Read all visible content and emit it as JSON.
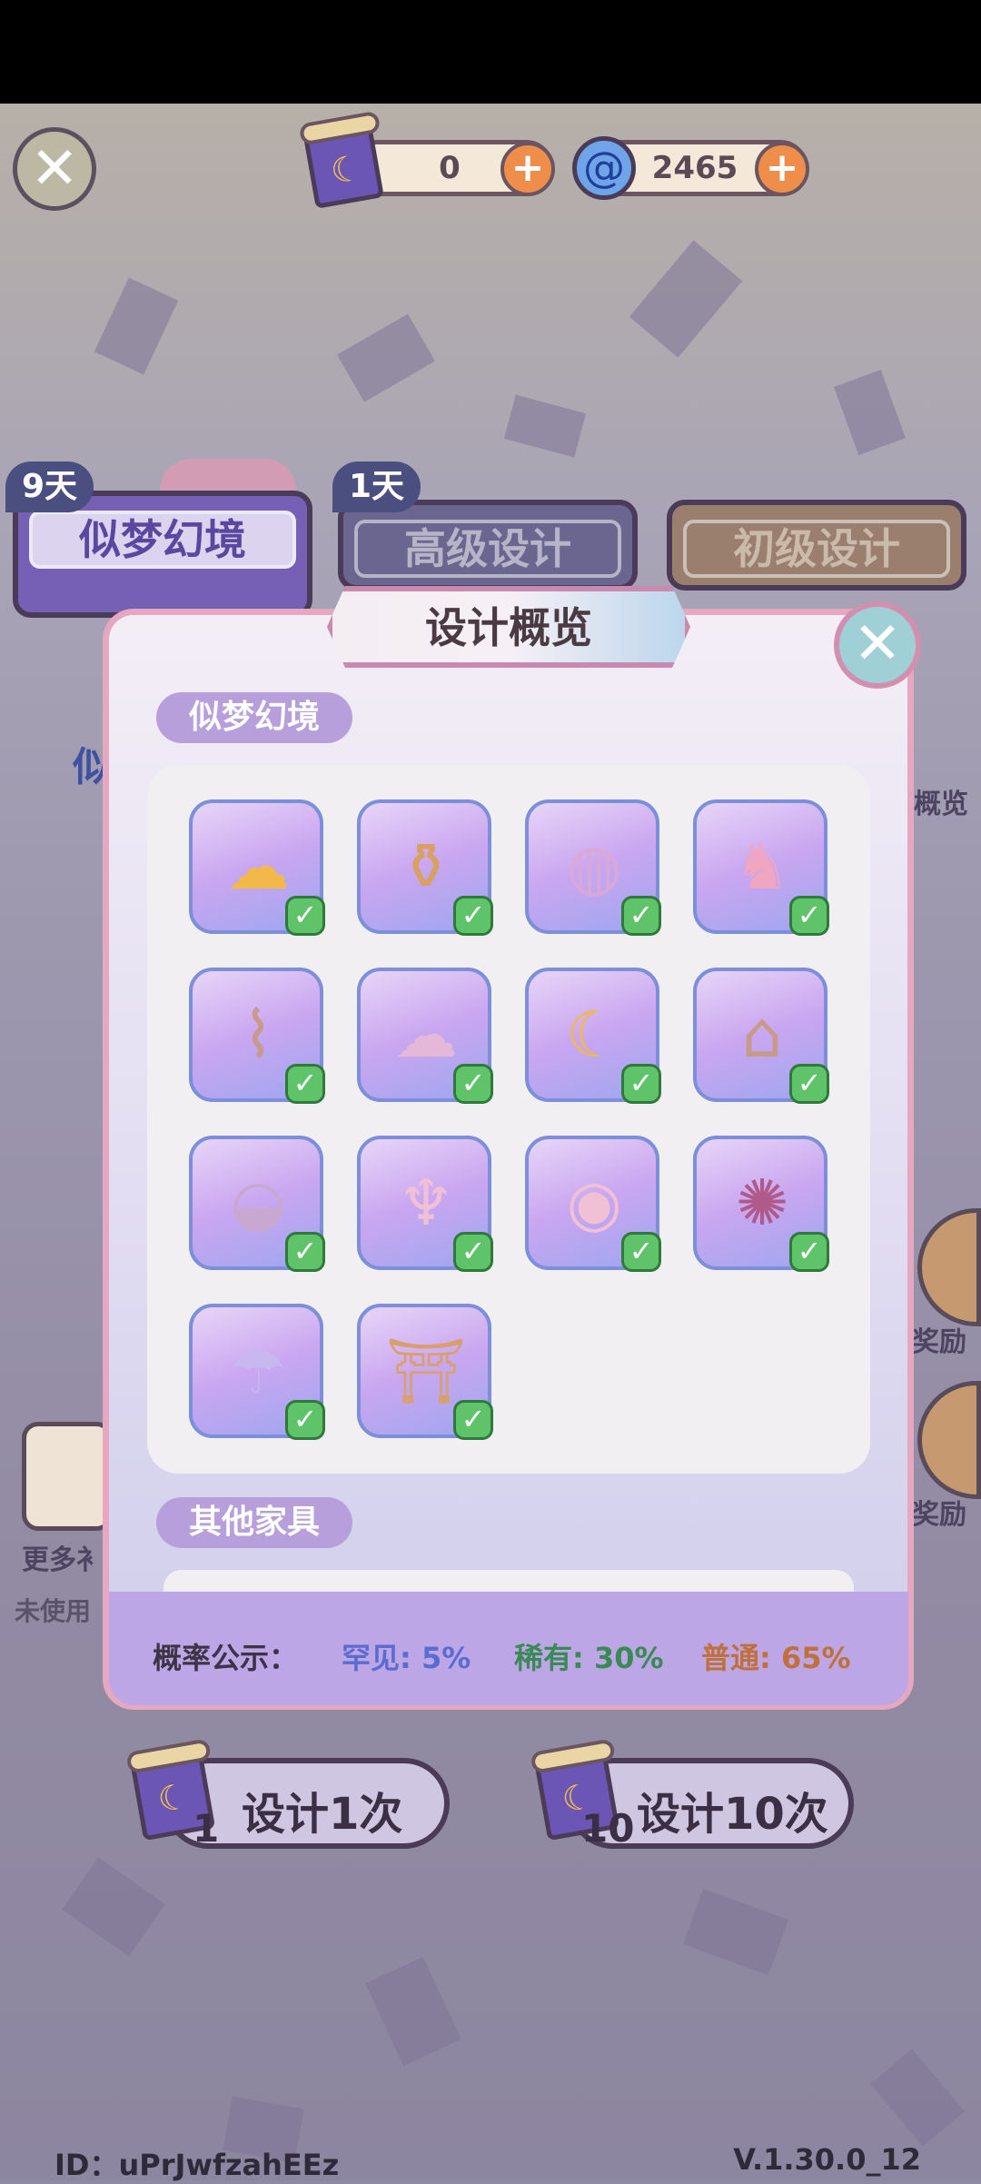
{
  "currencies": {
    "scroll_count": "0",
    "swirl_count": "2465"
  },
  "tabs": [
    {
      "label": "似梦幻境",
      "days": "9天"
    },
    {
      "label": "高级设计",
      "days": "1天"
    },
    {
      "label": "初级设计"
    }
  ],
  "side": {
    "left_partial": "似",
    "left_more": "更多衤",
    "left_unused": "未使用",
    "right_overview": "概览",
    "right_reward1": "奖励",
    "right_reward2": "奖励"
  },
  "modal": {
    "title": "设计概览",
    "section1": "似梦幻境",
    "section2": "其他家具",
    "items": [
      {
        "icon": "cloud-cushion-icon",
        "glyph": "☁",
        "color": "#f2b84a",
        "owned": true
      },
      {
        "icon": "vase-icon",
        "glyph": "⚱",
        "color": "#d9a064",
        "owned": true
      },
      {
        "icon": "cloud-rug-icon",
        "glyph": "◍",
        "color": "#d8a8d8",
        "owned": true
      },
      {
        "icon": "unicorn-icon",
        "glyph": "♞",
        "color": "#f0a6c0",
        "owned": true
      },
      {
        "icon": "curtain-icon",
        "glyph": "⌇",
        "color": "#c89a8a",
        "owned": true
      },
      {
        "icon": "cloud-bed-icon",
        "glyph": "☁",
        "color": "#e4b8d8",
        "owned": true
      },
      {
        "icon": "moon-lamp-icon",
        "glyph": "☾",
        "color": "#f2b84a",
        "owned": true
      },
      {
        "icon": "hanging-chair-icon",
        "glyph": "⌂",
        "color": "#c89a8a",
        "owned": true
      },
      {
        "icon": "round-table-icon",
        "glyph": "◒",
        "color": "#c8a8d0",
        "owned": true
      },
      {
        "icon": "cloud-stool-icon",
        "glyph": "♆",
        "color": "#f0c0d4",
        "owned": true
      },
      {
        "icon": "cloud-side-table-icon",
        "glyph": "◉",
        "color": "#f0c0d4",
        "owned": true
      },
      {
        "icon": "dreamcatcher-icon",
        "glyph": "✺",
        "color": "#b05a8a",
        "owned": true
      },
      {
        "icon": "rain-cloud-icon",
        "glyph": "☂",
        "color": "#c8b8f0",
        "owned": true
      },
      {
        "icon": "arch-door-icon",
        "glyph": "⛩",
        "color": "#d8a070",
        "owned": true
      }
    ]
  },
  "probability": {
    "label": "概率公示：",
    "rare": "罕见: 5%",
    "uncommon": "稀有: 30%",
    "common": "普通: 65%"
  },
  "buttons": {
    "design_once": "设计1次",
    "once_count": "1",
    "design_ten": "设计10次",
    "ten_count": "10"
  },
  "footer": {
    "id": "ID：uPrJwfzahEEz",
    "version": "V.1.30.0_12"
  }
}
